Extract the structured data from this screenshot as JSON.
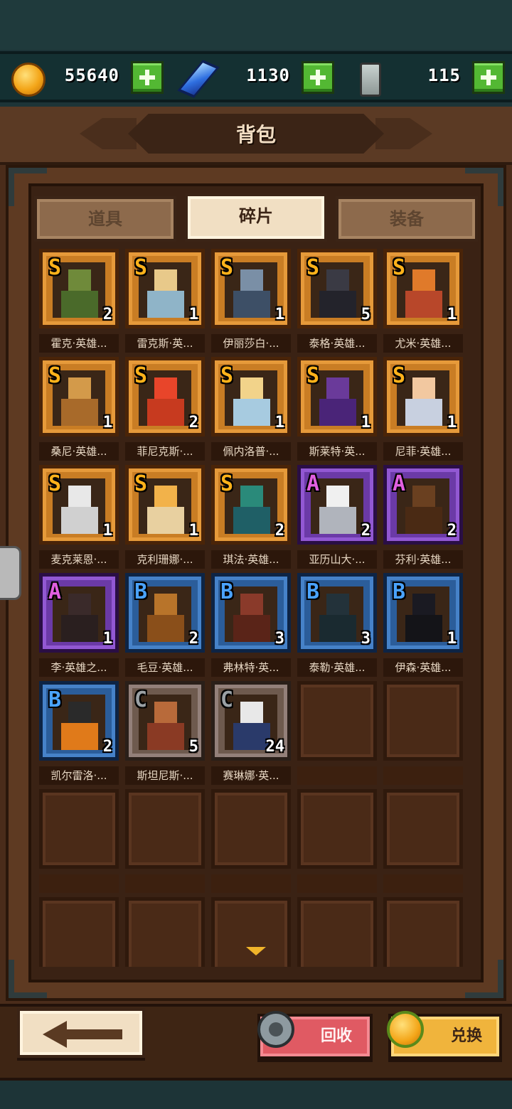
{
  "resources": [
    {
      "icon": "gold-coin-icon",
      "value": "55640"
    },
    {
      "icon": "blue-crystal-icon",
      "value": "1130"
    },
    {
      "icon": "potion-bottle-icon",
      "value": "115"
    }
  ],
  "title": "背包",
  "tabs": [
    {
      "label": "道具",
      "active": false
    },
    {
      "label": "碎片",
      "active": true
    },
    {
      "label": "装备",
      "active": false
    }
  ],
  "items": [
    {
      "name": "霍克·英雄...",
      "rank": "S",
      "count": "2",
      "head": "#6f8a3a",
      "body": "#4a6a2a"
    },
    {
      "name": "雷克斯·英...",
      "rank": "S",
      "count": "1",
      "head": "#e8c98a",
      "body": "#8fb4c8"
    },
    {
      "name": "伊丽莎白·...",
      "rank": "S",
      "count": "1",
      "head": "#7a8fa6",
      "body": "#3d4f66"
    },
    {
      "name": "泰格·英雄...",
      "rank": "S",
      "count": "5",
      "head": "#3a3a44",
      "body": "#23232b"
    },
    {
      "name": "尤米·英雄...",
      "rank": "S",
      "count": "1",
      "head": "#e07a2a",
      "body": "#b8472a"
    },
    {
      "name": "桑尼·英雄...",
      "rank": "S",
      "count": "1",
      "head": "#d39a4a",
      "body": "#a86a2a"
    },
    {
      "name": "菲尼克斯·...",
      "rank": "S",
      "count": "2",
      "head": "#e8452a",
      "body": "#c73a1f"
    },
    {
      "name": "佩内洛普·...",
      "rank": "S",
      "count": "1",
      "head": "#f2d38a",
      "body": "#a7cbe0"
    },
    {
      "name": "斯莱特·英...",
      "rank": "S",
      "count": "1",
      "head": "#6a3a9a",
      "body": "#4a2478"
    },
    {
      "name": "尼菲·英雄...",
      "rank": "S",
      "count": "1",
      "head": "#f2c8a0",
      "body": "#c8d0e0"
    },
    {
      "name": "麦克莱恩·...",
      "rank": "S",
      "count": "1",
      "head": "#e8e8e8",
      "body": "#d0d0d0"
    },
    {
      "name": "克利珊娜·...",
      "rank": "S",
      "count": "1",
      "head": "#f2b24a",
      "body": "#e8d0a0"
    },
    {
      "name": "琪法·英雄...",
      "rank": "S",
      "count": "2",
      "head": "#2a8a7a",
      "body": "#1f5f66"
    },
    {
      "name": "亚历山大·...",
      "rank": "A",
      "count": "2",
      "head": "#f0f0f0",
      "body": "#b0b4bc"
    },
    {
      "name": "芬利·英雄...",
      "rank": "A",
      "count": "2",
      "head": "#6a4020",
      "body": "#4a2a14"
    },
    {
      "name": "李·英雄之...",
      "rank": "A",
      "count": "1",
      "head": "#3a2a2a",
      "body": "#2a1f1f"
    },
    {
      "name": "毛豆·英雄...",
      "rank": "B",
      "count": "2",
      "head": "#b8742a",
      "body": "#8a4f1a"
    },
    {
      "name": "弗林特·英...",
      "rank": "B",
      "count": "3",
      "head": "#8a3a2a",
      "body": "#5a2418"
    },
    {
      "name": "泰勒·英雄...",
      "rank": "B",
      "count": "3",
      "head": "#23323a",
      "body": "#1a2a30"
    },
    {
      "name": "伊森·英雄...",
      "rank": "B",
      "count": "1",
      "head": "#1a1a22",
      "body": "#141418"
    },
    {
      "name": "凯尔雷洛·...",
      "rank": "B",
      "count": "2",
      "head": "#2a2a2a",
      "body": "#e07a1a"
    },
    {
      "name": "斯坦尼斯·...",
      "rank": "C",
      "count": "5",
      "head": "#b86a3a",
      "body": "#8a3a24"
    },
    {
      "name": "赛琳娜·英...",
      "rank": "C",
      "count": "24",
      "head": "#e8e8e8",
      "body": "#2a3a6a"
    }
  ],
  "footer": {
    "back_icon": "back-arrow-icon",
    "recycle_label": "回收",
    "exchange_label": "兑换"
  }
}
